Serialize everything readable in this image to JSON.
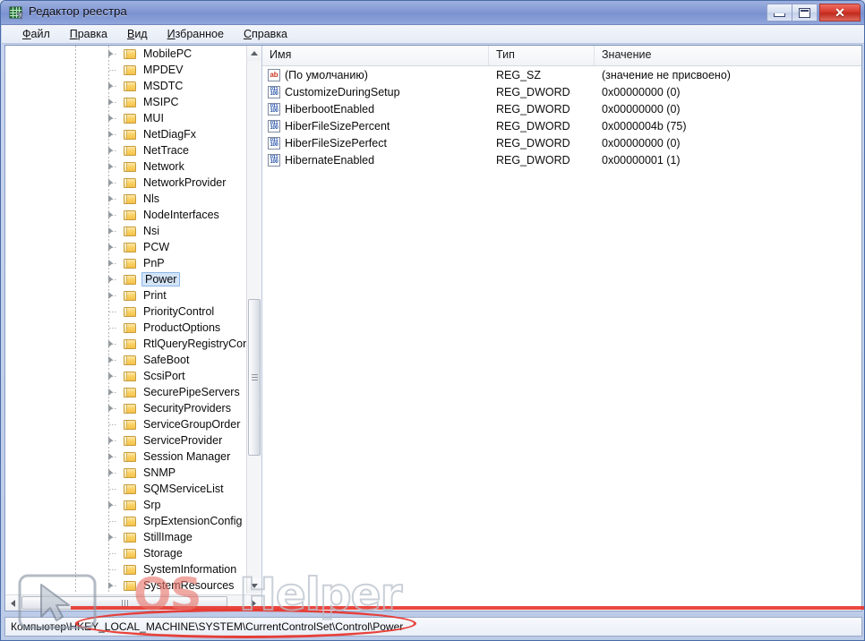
{
  "window": {
    "title": "Редактор реестра",
    "icon": "registry-editor-icon",
    "buttons": {
      "minimize": "–",
      "maximize": "□",
      "close": "✕"
    }
  },
  "menu": {
    "items": [
      {
        "accel": "Ф",
        "rest": "айл"
      },
      {
        "accel": "П",
        "rest": "равка"
      },
      {
        "accel": "В",
        "rest": "ид"
      },
      {
        "accel": "И",
        "rest": "збранное"
      },
      {
        "accel": "С",
        "rest": "правка"
      }
    ]
  },
  "tree": {
    "selected": "Power",
    "nodes": [
      {
        "label": "MobilePC",
        "expandable": true
      },
      {
        "label": "MPDEV",
        "expandable": false
      },
      {
        "label": "MSDTC",
        "expandable": true
      },
      {
        "label": "MSIPC",
        "expandable": true
      },
      {
        "label": "MUI",
        "expandable": true
      },
      {
        "label": "NetDiagFx",
        "expandable": true
      },
      {
        "label": "NetTrace",
        "expandable": true
      },
      {
        "label": "Network",
        "expandable": true
      },
      {
        "label": "NetworkProvider",
        "expandable": true
      },
      {
        "label": "Nls",
        "expandable": true
      },
      {
        "label": "NodeInterfaces",
        "expandable": true
      },
      {
        "label": "Nsi",
        "expandable": true
      },
      {
        "label": "PCW",
        "expandable": true
      },
      {
        "label": "PnP",
        "expandable": true
      },
      {
        "label": "Power",
        "expandable": true,
        "selected": true
      },
      {
        "label": "Print",
        "expandable": true
      },
      {
        "label": "PriorityControl",
        "expandable": false
      },
      {
        "label": "ProductOptions",
        "expandable": false
      },
      {
        "label": "RtlQueryRegistryConfig",
        "expandable": true
      },
      {
        "label": "SafeBoot",
        "expandable": true
      },
      {
        "label": "ScsiPort",
        "expandable": true
      },
      {
        "label": "SecurePipeServers",
        "expandable": true
      },
      {
        "label": "SecurityProviders",
        "expandable": true
      },
      {
        "label": "ServiceGroupOrder",
        "expandable": false
      },
      {
        "label": "ServiceProvider",
        "expandable": true
      },
      {
        "label": "Session Manager",
        "expandable": true
      },
      {
        "label": "SNMP",
        "expandable": true
      },
      {
        "label": "SQMServiceList",
        "expandable": false
      },
      {
        "label": "Srp",
        "expandable": true
      },
      {
        "label": "SrpExtensionConfig",
        "expandable": false
      },
      {
        "label": "StillImage",
        "expandable": true
      },
      {
        "label": "Storage",
        "expandable": false
      },
      {
        "label": "SystemInformation",
        "expandable": false
      },
      {
        "label": "SystemResources",
        "expandable": true
      }
    ]
  },
  "list": {
    "columns": [
      "Имя",
      "Тип",
      "Значение"
    ],
    "rows": [
      {
        "icon": "string-value-icon",
        "kind": "ab",
        "name": "(По умолчанию)",
        "type": "REG_SZ",
        "value": "(значение не присвоено)"
      },
      {
        "icon": "dword-value-icon",
        "kind": "dw",
        "name": "CustomizeDuringSetup",
        "type": "REG_DWORD",
        "value": "0x00000000 (0)"
      },
      {
        "icon": "dword-value-icon",
        "kind": "dw",
        "name": "HiberbootEnabled",
        "type": "REG_DWORD",
        "value": "0x00000000 (0)"
      },
      {
        "icon": "dword-value-icon",
        "kind": "dw",
        "name": "HiberFileSizePercent",
        "type": "REG_DWORD",
        "value": "0x0000004b (75)"
      },
      {
        "icon": "dword-value-icon",
        "kind": "dw",
        "name": "HiberFileSizePerfect",
        "type": "REG_DWORD",
        "value": "0x00000000 (0)"
      },
      {
        "icon": "dword-value-icon",
        "kind": "dw",
        "name": "HibernateEnabled",
        "type": "REG_DWORD",
        "value": "0x00000001 (1)"
      }
    ]
  },
  "status": {
    "prefix": "Компьютер\\",
    "path": "HKEY_LOCAL_MACHINE\\SYSTEM\\CurrentControlSet\\Control\\Power"
  },
  "watermark": {
    "part1": "OS",
    "part2": "Helper"
  },
  "colors": {
    "titlebar": "#8298d4",
    "annotation_red": "#e8332a",
    "selection_fill": "#d4e4f7",
    "selection_border": "#8ab6e6",
    "folder": "#fbd268"
  }
}
